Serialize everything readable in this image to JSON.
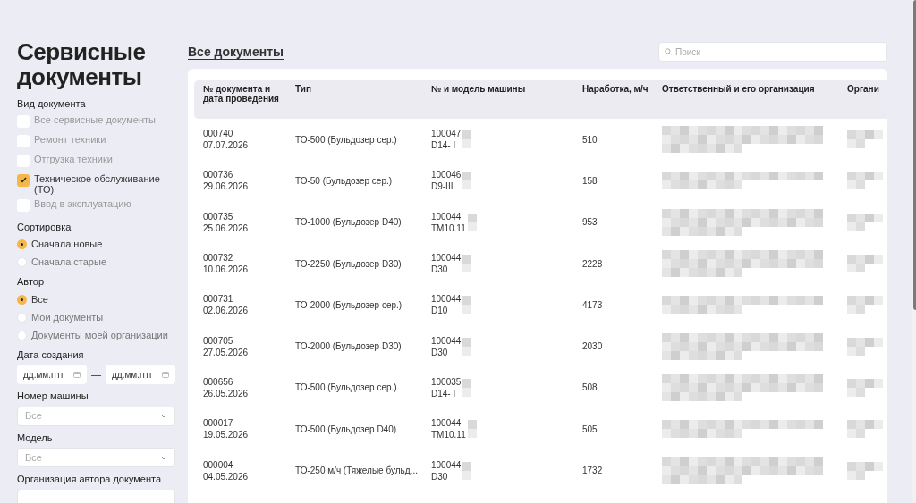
{
  "sidebar": {
    "title": "Сервисные документы",
    "doc_type": {
      "label": "Вид документа",
      "options": [
        {
          "label": "Все сервисные документы",
          "checked": false
        },
        {
          "label": "Ремонт техники",
          "checked": false
        },
        {
          "label": "Отгрузка техники",
          "checked": false
        },
        {
          "label": "Техническое обслуживание (ТО)",
          "checked": true
        },
        {
          "label": "Ввод в эксплуатацию",
          "checked": false
        }
      ]
    },
    "sort": {
      "label": "Сортировка",
      "options": [
        {
          "label": "Сначала новые",
          "selected": true
        },
        {
          "label": "Сначала старые",
          "selected": false
        }
      ]
    },
    "author": {
      "label": "Автор",
      "options": [
        {
          "label": "Все",
          "selected": true
        },
        {
          "label": "Мои документы",
          "selected": false
        },
        {
          "label": "Документы моей организации",
          "selected": false
        }
      ]
    },
    "date": {
      "label": "Дата создания",
      "from_placeholder": "дд.мм.гггг",
      "separator": "—",
      "to_placeholder": "дд.мм.гггг"
    },
    "selects": [
      {
        "label": "Номер машины",
        "value": "Все"
      },
      {
        "label": "Модель",
        "value": "Все"
      },
      {
        "label": "Организация автора документа"
      }
    ]
  },
  "main": {
    "tab": "Все документы",
    "search": {
      "placeholder": "Поиск"
    },
    "table": {
      "columns": [
        "№ документа и дата проведения",
        "Тип",
        "№ и модель машины",
        "Наработка, м/ч",
        "Ответственный и его организация",
        "Органи"
      ],
      "rows": [
        {
          "number": "000740",
          "date": "07.07.2026",
          "type": "ТО-500 (Бульдозер сер.)",
          "machine": "100047",
          "model": "D14- I",
          "hours": "510"
        },
        {
          "number": "000736",
          "date": "29.06.2026",
          "type": "ТО-50 (Бульдозер сер.)",
          "machine": "100046",
          "model": "D9-III",
          "hours": "158"
        },
        {
          "number": "000735",
          "date": "25.06.2026",
          "type": "ТО-1000 (Бульдозер D40)",
          "machine": "100044",
          "model": "TM10.11",
          "hours": "953"
        },
        {
          "number": "000732",
          "date": "10.06.2026",
          "type": "ТО-2250 (Бульдозер D30)",
          "machine": "100044",
          "model": "D30",
          "hours": "2228"
        },
        {
          "number": "000731",
          "date": "02.06.2026",
          "type": "ТО-2000 (Бульдозер сер.)",
          "machine": "100044",
          "model": "D10",
          "hours": "4173"
        },
        {
          "number": "000705",
          "date": "27.05.2026",
          "type": "ТО-2000 (Бульдозер D30)",
          "machine": "100044",
          "model": "D30",
          "hours": "2030"
        },
        {
          "number": "000656",
          "date": "26.05.2026",
          "type": "ТО-500 (Бульдозер сер.)",
          "machine": "100035",
          "model": "D14- I",
          "hours": "508"
        },
        {
          "number": "000017",
          "date": "19.05.2026",
          "type": "ТО-500 (Бульдозер D40)",
          "machine": "100044",
          "model": "TM10.11",
          "hours": "505"
        },
        {
          "number": "000004",
          "date": "04.05.2026",
          "type": "ТО-250 м/ч (Тяжелые бульд...",
          "machine": "100044",
          "model": "D30",
          "hours": "1732"
        }
      ]
    }
  }
}
